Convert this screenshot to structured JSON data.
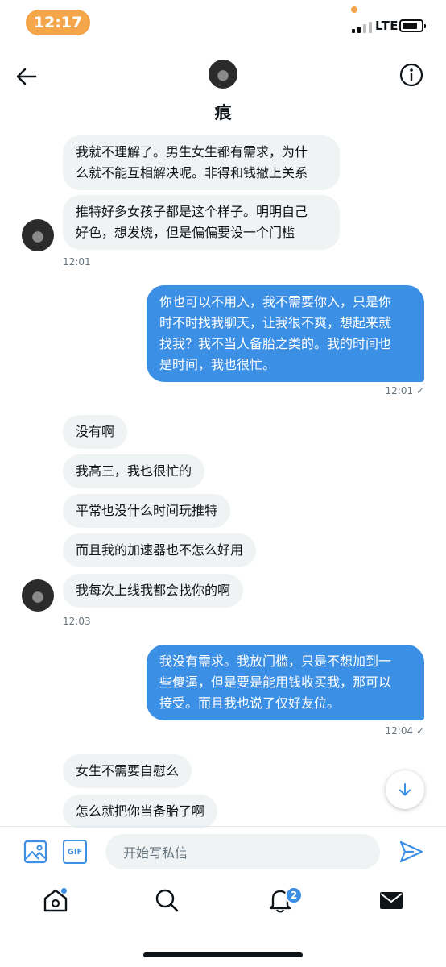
{
  "status_bar": {
    "time": "12:17",
    "network": "LTE"
  },
  "header": {
    "name": "痕"
  },
  "messages": {
    "g1": [
      "我就不理解了。男生女生都有需求，为什\n么就不能互相解决呢。非得和钱撤上关系",
      "推特好多女孩子都是这个样子。明明自己\n好色，想发烧，但是偏偏要设一个门槛"
    ],
    "g1_time": "12:01",
    "o1": "你也可以不用入，我不需要你入，只是你\n时不时找我聊天，让我很不爽，想起来就\n找我？我不当人备胎之类的。我的时间也\n是时间，我也很忙。",
    "o1_time": "12:01 ✓",
    "g2": [
      "没有啊",
      "我高三，我也很忙的",
      "平常也没什么时间玩推特",
      "而且我的加速器也不怎么好用",
      "我每次上线我都会找你的啊"
    ],
    "g2_time": "12:03",
    "o2": "我没有需求。我放门槛，只是不想加到一\n些傻逼，但是要是能用钱收买我，那可以\n接受。而且我也说了仅好友位。",
    "o2_time": "12:04 ✓",
    "g3": [
      "女生不需要自慰么",
      "怎么就把你当备胎了啊"
    ]
  },
  "composer": {
    "placeholder": "开始写私信",
    "gif_label": "GIF"
  },
  "tabbar": {
    "notifications_count": "2"
  },
  "colors": {
    "accent": "#3b8fe5",
    "status_pill": "#f5a54a"
  }
}
